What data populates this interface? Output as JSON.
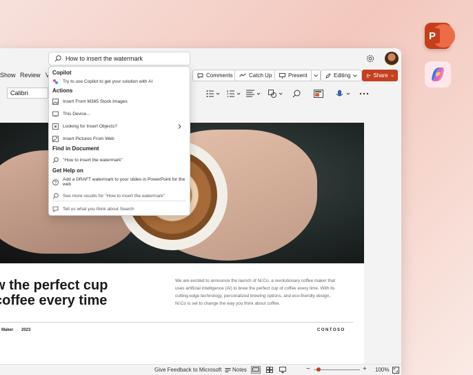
{
  "search": {
    "query": "How to insert the watermark"
  },
  "dropdown": {
    "copilot_heading": "Copilot",
    "copilot_item": "Try to use Copilot to get your solution with AI",
    "actions_heading": "Actions",
    "actions": [
      "Insert From M365 Stock Images",
      "This Device...",
      "Looking for Insert Objects?",
      "Insert Pictures From Web"
    ],
    "find_heading": "Find in Document",
    "find_item": "\"How to insert the watermark\"",
    "help_heading": "Get Help on",
    "help_item": "Add a DRAFT watermark to your slides in PowerPoint for the web",
    "more_results": "See more results for \"How to insert the watermark\"",
    "feedback": "Tell us what you think about Search"
  },
  "menubar": {
    "items": [
      "Show",
      "Review",
      "V"
    ]
  },
  "toolbar": {
    "comments": "Comments",
    "catch_up": "Catch Up",
    "present": "Present",
    "editing": "Editing",
    "share": "Share"
  },
  "ribbon": {
    "font": "Calibri"
  },
  "slide": {
    "headline_line1": "w the perfect cup",
    "headline_line2": "coffee every time",
    "body": "We are excited to announce the launch of Ni:Co, a revolutionary coffee maker that uses artificial intelligence (AI) to brew the perfect cup of coffee every time. With its cutting-edge technology, personalized brewing options, and eco-friendly design, Ni:Co is set to change the way you think about coffee.",
    "footer_left": "Maker",
    "footer_year": "2023",
    "footer_brand": "CONTOSO"
  },
  "statusbar": {
    "feedback": "Give Feedback to Microsoft",
    "notes": "Notes",
    "zoom": "100%",
    "zoom_level": 0.11
  },
  "colors": {
    "accent": "#c4401f",
    "copilot_icon_bg": "#fde7ea"
  },
  "icons": [
    "powerpoint-app-icon",
    "copilot-app-icon",
    "settings-icon",
    "search-icon",
    "chevron-right-icon",
    "present-icon",
    "comments-icon",
    "catch-up-icon",
    "editing-icon",
    "share-icon"
  ]
}
